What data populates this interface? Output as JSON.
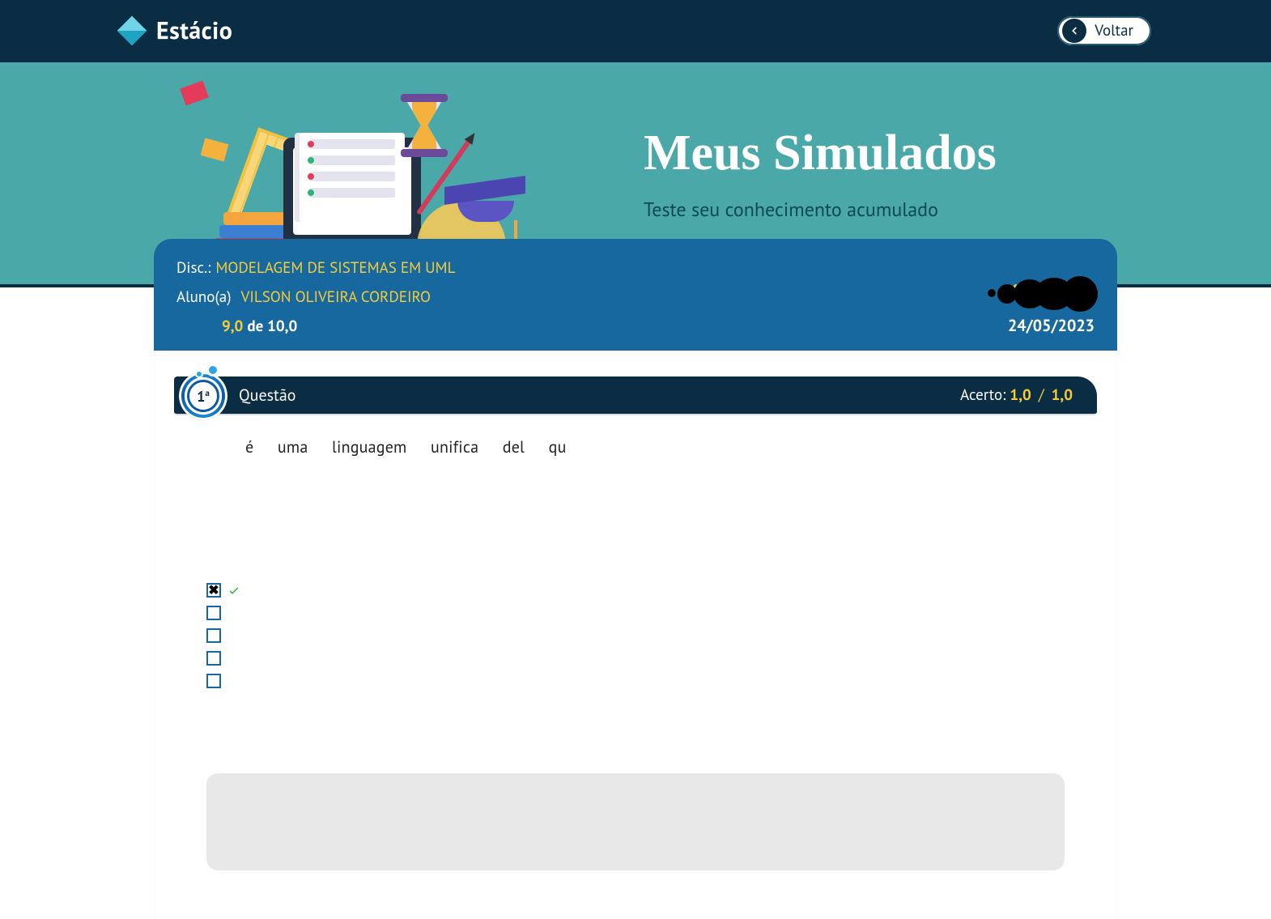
{
  "brand": {
    "name": "Estácio"
  },
  "back_button": {
    "label": "Voltar"
  },
  "hero": {
    "title": "Meus Simulados",
    "subtitle": "Teste seu conhecimento acumulado"
  },
  "summary": {
    "disc_label": "Disc.:",
    "disc_value": "MODELAGEM DE SISTEMAS EM UML",
    "student_label": "Aluno(a)",
    "student_value": "VILSON OLIVEIRA CORDEIRO",
    "score_value": "9,0",
    "score_of": "de 10,0",
    "date": "24/05/2023"
  },
  "question": {
    "number": "1",
    "ord_suffix": "a",
    "label": "Questão",
    "acerto_label": "Acerto:",
    "acerto_value": "1,0",
    "acerto_max": "1,0",
    "text": "é uma linguagem unifica del qu",
    "options": [
      {
        "selected": true,
        "correct": true
      },
      {
        "selected": false,
        "correct": false
      },
      {
        "selected": false,
        "correct": false
      },
      {
        "selected": false,
        "correct": false
      },
      {
        "selected": false,
        "correct": false
      }
    ]
  }
}
